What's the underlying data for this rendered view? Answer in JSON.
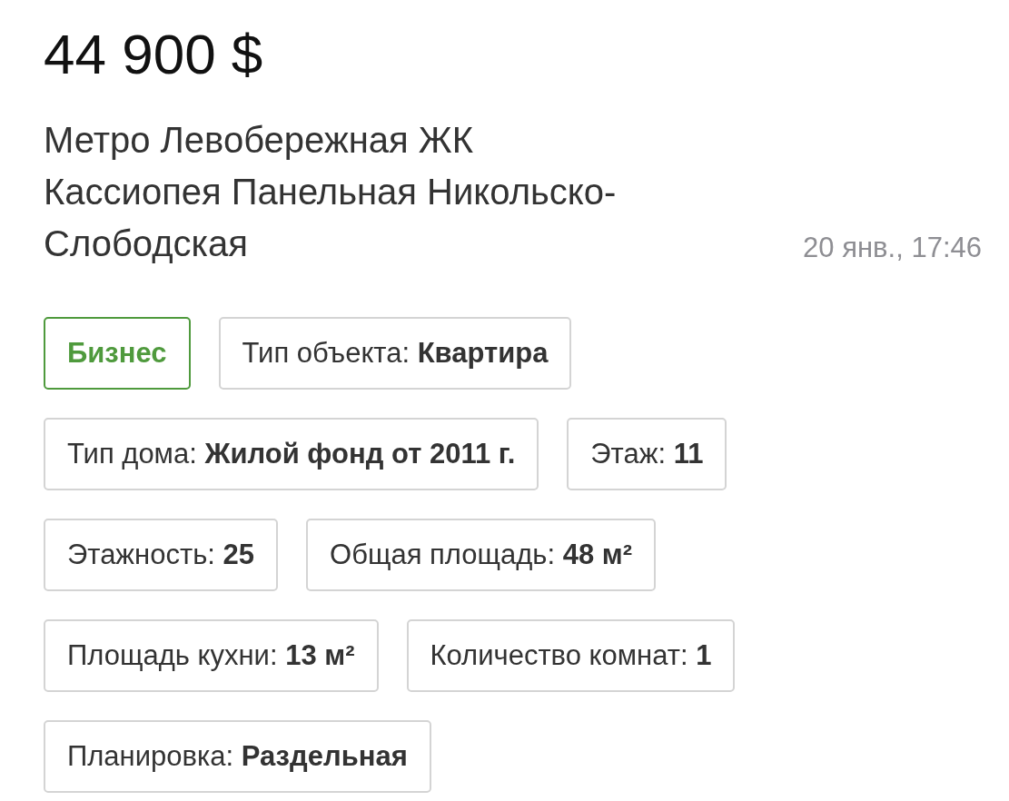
{
  "price": "44 900 $",
  "title": "Метро Левобережная ЖК Кассиопея Панельная Никольско-Слободская",
  "date": "20 янв., 17:46",
  "tag_rows": [
    [
      {
        "kind": "category",
        "label": "Бизнес"
      },
      {
        "kind": "param",
        "label": "Тип объекта:",
        "value": "Квартира"
      }
    ],
    [
      {
        "kind": "param",
        "label": "Тип дома:",
        "value": "Жилой фонд от 2011 г."
      },
      {
        "kind": "param",
        "label": "Этаж:",
        "value": "11"
      }
    ],
    [
      {
        "kind": "param",
        "label": "Этажность:",
        "value": "25"
      },
      {
        "kind": "param",
        "label": "Общая площадь:",
        "value": "48 м²"
      }
    ],
    [
      {
        "kind": "param",
        "label": "Площадь кухни:",
        "value": "13 м²"
      },
      {
        "kind": "param",
        "label": "Количество комнат:",
        "value": "1"
      }
    ],
    [
      {
        "kind": "param",
        "label": "Планировка:",
        "value": "Раздельная"
      }
    ]
  ]
}
